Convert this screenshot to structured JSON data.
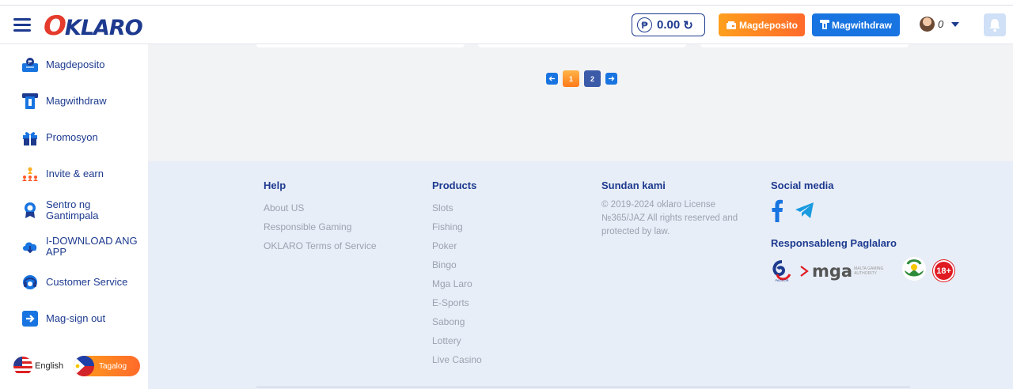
{
  "header": {
    "logo_o": "O",
    "logo_rest": "KLARO",
    "balance": "0.00",
    "currency_symbol": "₱",
    "deposit_label": "Magdeposito",
    "withdraw_label": "Magwithdraw",
    "user_count": "0"
  },
  "sidebar": {
    "items": [
      {
        "label": "Magdeposito",
        "icon": "deposit-icon"
      },
      {
        "label": "Magwithdraw",
        "icon": "withdraw-icon"
      },
      {
        "label": "Promosyon",
        "icon": "gift-icon"
      },
      {
        "label": "Invite & earn",
        "icon": "invite-icon"
      },
      {
        "label": "Sentro ng Gantimpala",
        "icon": "reward-icon"
      },
      {
        "label": "I-DOWNLOAD ANG APP",
        "icon": "cloud-download-icon"
      },
      {
        "label": "Customer Service",
        "icon": "headset-icon"
      },
      {
        "label": "Mag-sign out",
        "icon": "sign-out-icon"
      }
    ],
    "languages": {
      "english": "English",
      "tagalog": "Tagalog"
    }
  },
  "pagination": {
    "pages": [
      "1",
      "2"
    ],
    "current": "1"
  },
  "footer": {
    "help": {
      "title": "Help",
      "links": [
        "About US",
        "Responsible Gaming",
        "OKLARO Terms of Service"
      ]
    },
    "products": {
      "title": "Products",
      "links": [
        "Slots",
        "Fishing",
        "Poker",
        "Bingo",
        "Mga Laro",
        "E-Sports",
        "Sabong",
        "Lottery",
        "Live Casino"
      ]
    },
    "contact": {
      "title": "Sundan kami",
      "text": "© 2019-2024 oklaro License №365/JAZ All rights reserved and protected by law."
    },
    "social": {
      "title": "Social media"
    },
    "responsible": {
      "title": "Responsableng Paglalaro",
      "mga": "mga",
      "mga_sub": "MALTA GAMING AUTHORITY",
      "pagcor": "PAGCOR",
      "age": "18+"
    }
  },
  "colors": {
    "brand_blue": "#1d3a8f",
    "accent_orange": "#ff7a1a",
    "action_blue": "#1874e0",
    "logo_red": "#e53b2c"
  }
}
